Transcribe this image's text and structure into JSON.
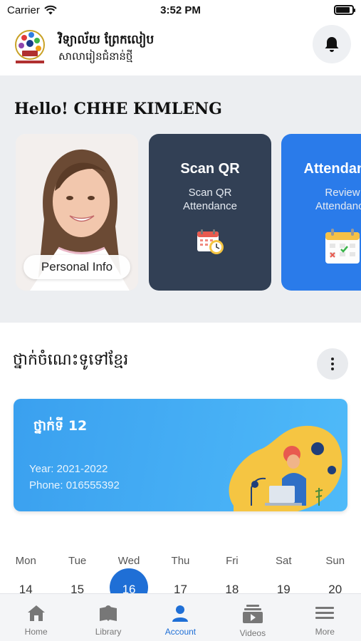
{
  "status_bar": {
    "carrier": "Carrier",
    "time": "3:52 PM",
    "battery_level": 0.85
  },
  "header": {
    "school_name": "វិទ្យាល័យ ព្រែកលៀប",
    "school_subtitle": "សាលារៀនជំនាន់ថ្មី"
  },
  "greeting": "Hello! CHHE KIMLENG",
  "cards": {
    "personal_info_label": "Personal Info",
    "scan_title": "Scan QR",
    "scan_desc": "Scan QR Attendance",
    "attendance_title": "Attendance",
    "attendance_desc": "Review Attendance"
  },
  "class_section": {
    "title": "ថ្នាក់ចំណេះទូទៅខ្មែរ",
    "class_name": "ថ្នាក់ទី 12",
    "year": "Year: 2021-2022",
    "phone": "Phone: 016555392"
  },
  "calendar": {
    "days": [
      "Mon",
      "Tue",
      "Wed",
      "Thu",
      "Fri",
      "Sat",
      "Sun"
    ],
    "dates": [
      "14",
      "15",
      "16",
      "17",
      "18",
      "19",
      "20"
    ],
    "selected_index": 2
  },
  "nav": [
    {
      "label": "Home",
      "icon": "home-icon"
    },
    {
      "label": "Library",
      "icon": "library-icon"
    },
    {
      "label": "Account",
      "icon": "account-icon",
      "active": true
    },
    {
      "label": "Videos",
      "icon": "videos-icon"
    },
    {
      "label": "More",
      "icon": "menu-icon"
    }
  ],
  "colors": {
    "accent": "#1f6fd6",
    "scan_card": "#324055",
    "attendance_card": "#2a7bea",
    "class_card": "#3aa0ef"
  }
}
